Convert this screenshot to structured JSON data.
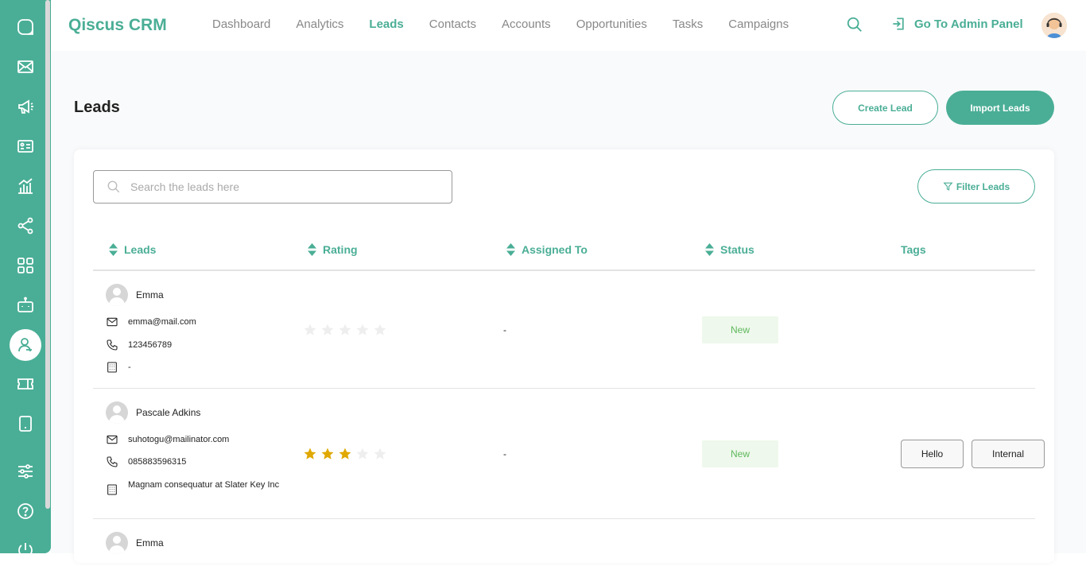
{
  "app": {
    "brand": "Qiscus CRM",
    "accent_color": "#4aae96"
  },
  "nav": {
    "items": [
      {
        "label": "Dashboard",
        "active": false
      },
      {
        "label": "Analytics",
        "active": false
      },
      {
        "label": "Leads",
        "active": true
      },
      {
        "label": "Contacts",
        "active": false
      },
      {
        "label": "Accounts",
        "active": false
      },
      {
        "label": "Opportunities",
        "active": false
      },
      {
        "label": "Tasks",
        "active": false
      },
      {
        "label": "Campaigns",
        "active": false
      }
    ],
    "admin_label": "Go To Admin Panel"
  },
  "sidebar": {
    "icons": [
      "chat-icon",
      "mail-icon",
      "megaphone-icon",
      "contact-card-icon",
      "analytics-icon",
      "share-icon",
      "apps-icon",
      "bot-icon",
      "crm-user-icon",
      "ticket-icon",
      "tablet-icon",
      "settings-sliders-icon",
      "help-icon",
      "power-icon"
    ],
    "active": "crm-user-icon"
  },
  "page": {
    "title": "Leads",
    "create_label": "Create Lead",
    "import_label": "Import Leads",
    "search_placeholder": "Search the leads here",
    "filter_label": "Filter Leads"
  },
  "table": {
    "headers": {
      "leads": "Leads",
      "rating": "Rating",
      "assigned": "Assigned To",
      "status": "Status",
      "tags": "Tags"
    },
    "rows": [
      {
        "name": "Emma",
        "email": "emma@mail.com",
        "phone": "123456789",
        "company": "-",
        "rating": 0,
        "assigned": "-",
        "status": "New",
        "tags": []
      },
      {
        "name": "Pascale Adkins",
        "email": "suhotogu@mailinator.com",
        "phone": "085883596315",
        "company": "Magnam consequatur at Slater Key Inc",
        "rating": 3,
        "assigned": "-",
        "status": "New",
        "tags": [
          "Hello",
          "Internal"
        ]
      },
      {
        "name": "Emma"
      }
    ]
  }
}
